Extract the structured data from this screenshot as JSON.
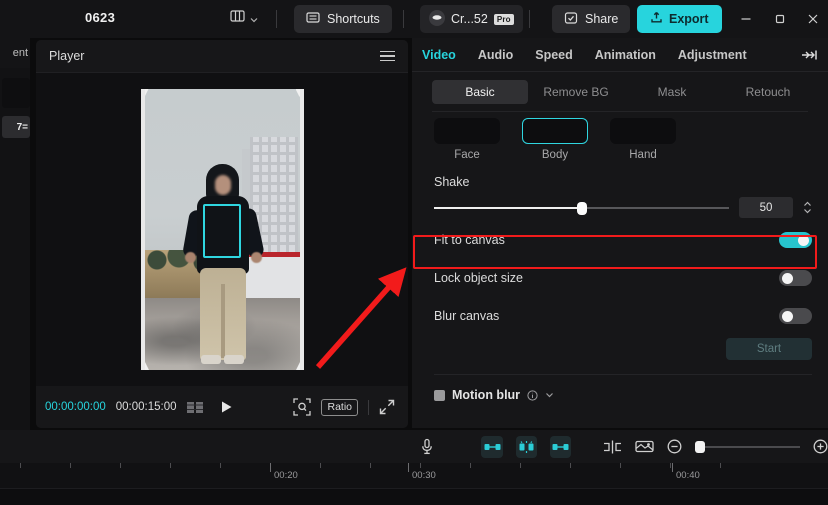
{
  "titlebar": {
    "project_name": "0623",
    "layout_icon": "layout-icon",
    "chevron_icon": "chevron-down-icon",
    "shortcuts_label": "Shortcuts",
    "shortcuts_icon": "keyboard-icon",
    "account_label": "Cr...52",
    "account_badge": "Pro",
    "account_icon": "avatar-icon",
    "share_label": "Share",
    "share_icon": "share-icon",
    "export_label": "Export",
    "export_icon": "upload-icon",
    "minimize_icon": "minimize-icon",
    "maximize_icon": "maximize-icon",
    "close_icon": "close-icon",
    "export_color": "#27d4dd"
  },
  "left_stub": {
    "header_text": "ent",
    "chip_text": "7="
  },
  "player": {
    "title": "Player",
    "menu_icon": "hamburger-menu-icon",
    "current_time": "00:00:00:00",
    "total_time": "00:00:15:00",
    "frames_icon": "frames-icon",
    "play_icon": "play-icon",
    "fit_icon": "fit-to-screen-icon",
    "ratio_label": "Ratio",
    "fullscreen_icon": "fullscreen-icon",
    "current_time_color": "#27d4dd"
  },
  "right_panel": {
    "tabs": [
      {
        "label": "Video",
        "active": true
      },
      {
        "label": "Audio",
        "active": false
      },
      {
        "label": "Speed",
        "active": false
      },
      {
        "label": "Animation",
        "active": false
      },
      {
        "label": "Adjustment",
        "active": false
      }
    ],
    "collapse_icon": "collapse-panel-icon",
    "subtabs": [
      {
        "label": "Basic",
        "active": true
      },
      {
        "label": "Remove BG",
        "active": false
      },
      {
        "label": "Mask",
        "active": false
      },
      {
        "label": "Retouch",
        "active": false
      }
    ],
    "body_parts": [
      {
        "label": "Face",
        "selected": false
      },
      {
        "label": "Body",
        "selected": true
      },
      {
        "label": "Hand",
        "selected": false
      }
    ],
    "shake": {
      "label": "Shake",
      "value": "50",
      "percent": 50
    },
    "options": [
      {
        "label": "Fit to canvas",
        "on": true
      },
      {
        "label": "Lock object size",
        "on": false
      },
      {
        "label": "Blur canvas",
        "on": false
      }
    ],
    "start_label": "Start",
    "motion_blur": {
      "label": "Motion blur",
      "info_icon": "info-icon",
      "chevron_icon": "chevron-down-icon",
      "checked": false
    },
    "accent_color": "#27d4dd"
  },
  "timeline": {
    "tools": [
      {
        "name": "microphone-icon",
        "highlighted": false
      },
      {
        "name": "transition-in-icon",
        "highlighted": true
      },
      {
        "name": "keyframe-icon",
        "highlighted": true
      },
      {
        "name": "transition-out-icon",
        "highlighted": true
      },
      {
        "name": "split-icon",
        "highlighted": false
      },
      {
        "name": "crop-icon",
        "highlighted": false
      },
      {
        "name": "zoom-out-icon",
        "highlighted": false
      }
    ],
    "zoom_in_icon": "zoom-in-icon",
    "ruler_labels": [
      "00:20",
      "00:30",
      "00:40"
    ]
  },
  "annotations": {
    "highlight_color": "#f21b1b",
    "highlight_target": "Fit to canvas",
    "arrow": "red-arrow-pointing-to-fit-to-canvas"
  }
}
